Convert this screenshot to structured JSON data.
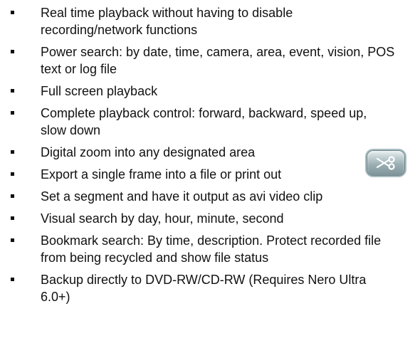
{
  "features": [
    {
      "text": "Real time playback without having to disable recording/network functions"
    },
    {
      "text": "Power search: by date, time, camera, area, event, vision, POS text or log file"
    },
    {
      "text": "Full screen playback"
    },
    {
      "text": "Complete playback control: forward, backward, speed up, slow down"
    },
    {
      "text": "Digital zoom into any designated area"
    },
    {
      "text": "Export a single frame into a file or print out"
    },
    {
      "text": "Set a segment and have it output as avi video clip"
    },
    {
      "text": "Visual search by day, hour, minute, second"
    },
    {
      "text": "Bookmark search: By time, description. Protect recorded file from being recycled and show file status"
    },
    {
      "text": "Backup directly to DVD-RW/CD-RW (Requires Nero Ultra 6.0+)"
    }
  ],
  "icon": {
    "name": "scissors-icon"
  }
}
